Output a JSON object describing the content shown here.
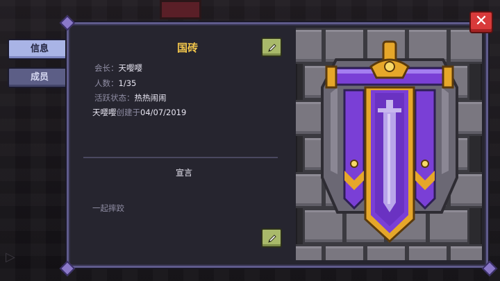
{
  "tabs": [
    {
      "label": "信息",
      "active": true
    },
    {
      "label": "成员",
      "active": false
    }
  ],
  "guild": {
    "name": "国砖",
    "leader_label": "会长：",
    "leader_value": "天嘤嘤",
    "members_label": "人数：",
    "members_value": "1/35",
    "activity_label": "活跃状态：",
    "activity_value": "热热闹闹",
    "creator": "天嘤嘤",
    "created_label": "创建于",
    "created_date": "04/07/2019"
  },
  "declaration": {
    "title": "宣言",
    "text": "一起摔跤"
  },
  "icons": {
    "edit": "pencil-icon",
    "close": "close-icon",
    "play": "play-icon",
    "banner": "guild-banner-sword-emblem"
  },
  "colors": {
    "title_gold": "#f2c64b",
    "banner_purple": "#7a3fd6",
    "close_red": "#d83a3a",
    "edit_green": "#a9b96a"
  },
  "close_glyph": "✕"
}
